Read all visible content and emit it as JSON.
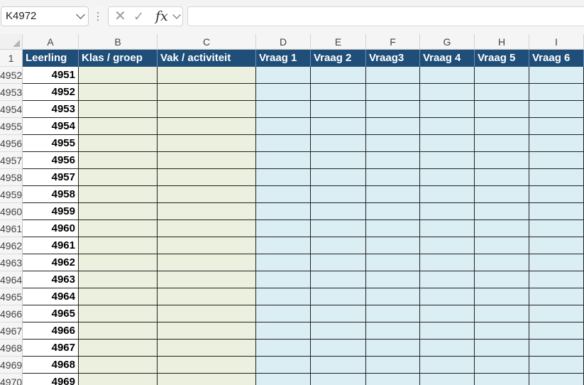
{
  "formula_bar": {
    "name_box": "K4972",
    "fx_label": "fx",
    "formula": ""
  },
  "column_letters": [
    "A",
    "B",
    "C",
    "D",
    "E",
    "F",
    "G",
    "H",
    "I"
  ],
  "header_row_number": "1",
  "header_labels": [
    "Leerling",
    "Klas / groep",
    "Vak / activiteit",
    "Vraag 1",
    "Vraag 2",
    "Vraag3",
    "Vraag 4",
    "Vraag 5",
    "Vraag 6"
  ],
  "rows": [
    {
      "row": "4952",
      "leerling": "4951"
    },
    {
      "row": "4953",
      "leerling": "4952"
    },
    {
      "row": "4954",
      "leerling": "4953"
    },
    {
      "row": "4955",
      "leerling": "4954"
    },
    {
      "row": "4956",
      "leerling": "4955"
    },
    {
      "row": "4957",
      "leerling": "4956"
    },
    {
      "row": "4958",
      "leerling": "4957"
    },
    {
      "row": "4959",
      "leerling": "4958"
    },
    {
      "row": "4960",
      "leerling": "4959"
    },
    {
      "row": "4961",
      "leerling": "4960"
    },
    {
      "row": "4962",
      "leerling": "4961"
    },
    {
      "row": "4963",
      "leerling": "4962"
    },
    {
      "row": "4964",
      "leerling": "4963"
    },
    {
      "row": "4965",
      "leerling": "4964"
    },
    {
      "row": "4966",
      "leerling": "4965"
    },
    {
      "row": "4967",
      "leerling": "4966"
    },
    {
      "row": "4968",
      "leerling": "4967"
    },
    {
      "row": "4969",
      "leerling": "4968"
    },
    {
      "row": "4970",
      "leerling": "4969"
    }
  ],
  "colors": {
    "header_fill": "#1f4e79",
    "input_green": "#ebf1de",
    "input_blue": "#daeef3"
  }
}
